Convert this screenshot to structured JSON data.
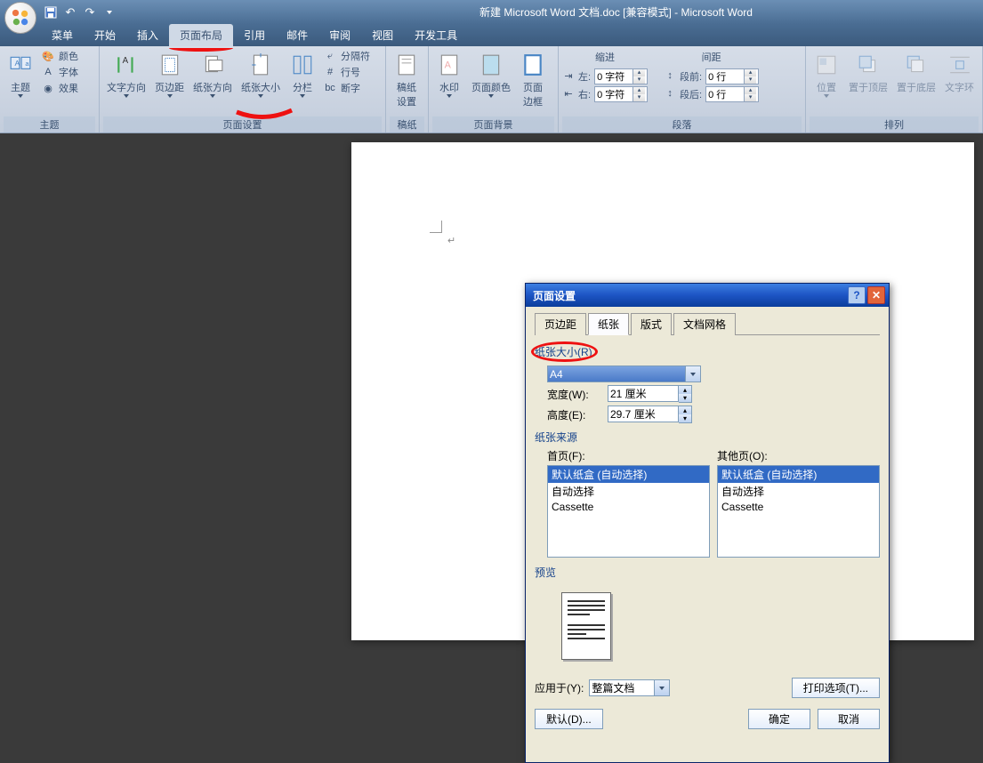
{
  "title": "新建 Microsoft Word 文档.doc [兼容模式] - Microsoft Word",
  "tabs": {
    "t0": "菜单",
    "t1": "开始",
    "t2": "插入",
    "t3": "页面布局",
    "t4": "引用",
    "t5": "邮件",
    "t6": "审阅",
    "t7": "视图",
    "t8": "开发工具"
  },
  "ribbon": {
    "theme": {
      "label": "主题",
      "colors": "颜色",
      "fonts": "字体",
      "effects": "效果",
      "themes": "主题"
    },
    "page_setup": {
      "label": "页面设置",
      "textdir": "文字方向",
      "margins": "页边距",
      "orient": "纸张方向",
      "size": "纸张大小",
      "columns": "分栏",
      "breaks": "分隔符",
      "linenum": "行号",
      "hyphen": "断字"
    },
    "draft": {
      "label": "稿纸",
      "settings": "稿纸\n设置"
    },
    "bg": {
      "label": "页面背景",
      "watermark": "水印",
      "color": "页面颜色",
      "border": "页面\n边框"
    },
    "para": {
      "label": "段落",
      "indent": "缩进",
      "spacing": "间距",
      "left": "左:",
      "right": "右:",
      "before": "段前:",
      "after": "段后:",
      "l_val": "0 字符",
      "r_val": "0 字符",
      "b_val": "0 行",
      "a_val": "0 行"
    },
    "arrange": {
      "label": "排列",
      "pos": "位置",
      "front": "置于顶层",
      "back": "置于底层",
      "wrap": "文字环"
    }
  },
  "dialog": {
    "title": "页面设置",
    "tabs": {
      "t0": "页边距",
      "t1": "纸张",
      "t2": "版式",
      "t3": "文档网格"
    },
    "size_label": "纸张大小(R)",
    "size_val": "A4",
    "width_label": "宽度(W):",
    "width_val": "21 厘米",
    "height_label": "高度(E):",
    "height_val": "29.7 厘米",
    "source_label": "纸张来源",
    "first_label": "首页(F):",
    "other_label": "其他页(O):",
    "opt0": "默认纸盒 (自动选择)",
    "opt1": "自动选择",
    "opt2": "Cassette",
    "preview": "预览",
    "apply_label": "应用于(Y):",
    "apply_val": "整篇文档",
    "printopt": "打印选项(T)...",
    "default": "默认(D)...",
    "ok": "确定",
    "cancel": "取消"
  }
}
